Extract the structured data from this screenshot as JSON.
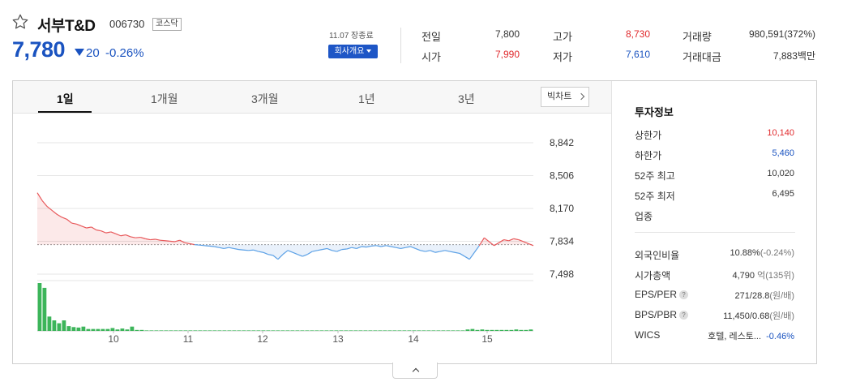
{
  "header": {
    "name": "서부T&D",
    "code": "006730",
    "market": "코스닥",
    "price": "7,780",
    "change": "20",
    "change_pct": "-0.26%",
    "date_close": "11.07 장종료",
    "company_button": "회사개요"
  },
  "stats": {
    "prev_close_label": "전일",
    "prev_close": "7,800",
    "open_label": "시가",
    "open": "7,990",
    "high_label": "고가",
    "high": "8,730",
    "low_label": "저가",
    "low": "7,610",
    "volume_label": "거래량",
    "volume": "980,591(372%)",
    "value_label": "거래대금",
    "value": "7,883백만"
  },
  "tabs": [
    "1일",
    "1개월",
    "3개월",
    "1년",
    "3년"
  ],
  "active_tab": "1일",
  "big_chart_label": "빅차트",
  "investment": {
    "title": "투자정보",
    "rows1": [
      {
        "label": "상한가",
        "value": "10,140",
        "color": "red"
      },
      {
        "label": "하한가",
        "value": "5,460",
        "color": "blue"
      },
      {
        "label": "52주 최고",
        "value": "10,020",
        "color": ""
      },
      {
        "label": "52주 최저",
        "value": "6,495",
        "color": ""
      },
      {
        "label": "업종",
        "value": "",
        "color": ""
      }
    ],
    "foreign_label": "외국인비율",
    "foreign_value": "10.88%",
    "foreign_change": "(-0.24%)",
    "mcap_label": "시가총액",
    "mcap_value": "4,790",
    "mcap_unit": "억(135위)",
    "eps_label": "EPS/PER",
    "eps_value": "271/28.8",
    "eps_unit": "(원/배)",
    "bps_label": "BPS/PBR",
    "bps_value": "11,450/0.68",
    "bps_unit": "(원/배)",
    "wics_label": "WICS",
    "wics_value": "호텔, 레스토...",
    "wics_change": "-0.46%"
  },
  "colors": {
    "up": "#e0292c",
    "down": "#1a53c0",
    "volume": "#3cb55a",
    "accent_button": "#1e56c6"
  },
  "chart_data": {
    "type": "line",
    "y_ticks": [
      "8,842",
      "8,506",
      "8,170",
      "7,834",
      "7,498"
    ],
    "ylim": [
      7498,
      8842
    ],
    "prev_close": 7800,
    "x_ticks": [
      "10",
      "11",
      "12",
      "13",
      "14",
      "15"
    ],
    "price_series": [
      8330,
      8250,
      8190,
      8150,
      8110,
      8080,
      8060,
      8020,
      8010,
      7990,
      7970,
      7980,
      7950,
      7940,
      7920,
      7930,
      7910,
      7890,
      7900,
      7880,
      7870,
      7875,
      7860,
      7850,
      7855,
      7845,
      7840,
      7835,
      7830,
      7845,
      7820,
      7810,
      7800,
      7795,
      7790,
      7785,
      7780,
      7770,
      7760,
      7770,
      7760,
      7750,
      7745,
      7740,
      7745,
      7730,
      7720,
      7700,
      7690,
      7650,
      7700,
      7740,
      7720,
      7700,
      7680,
      7700,
      7730,
      7740,
      7750,
      7760,
      7740,
      7730,
      7750,
      7755,
      7770,
      7760,
      7780,
      7775,
      7785,
      7790,
      7780,
      7790,
      7780,
      7770,
      7760,
      7770,
      7780,
      7760,
      7740,
      7730,
      7740,
      7720,
      7730,
      7740,
      7730,
      7720,
      7710,
      7680,
      7650,
      7720,
      7790,
      7870,
      7830,
      7790,
      7820,
      7850,
      7840,
      7860,
      7850,
      7830,
      7810,
      7790
    ],
    "volume_series": [
      100,
      90,
      30,
      22,
      16,
      22,
      10,
      8,
      7,
      9,
      4,
      4,
      4,
      4,
      4,
      6,
      3,
      5,
      3,
      9,
      2,
      2,
      1,
      1,
      1,
      1,
      1,
      1,
      1,
      1,
      1,
      1,
      1,
      1,
      1,
      1,
      1,
      1,
      1,
      1,
      1,
      1,
      1,
      1,
      1,
      1,
      1,
      1,
      1,
      1,
      1,
      1,
      1,
      1,
      1,
      1,
      1,
      1,
      1,
      1,
      1,
      1,
      1,
      1,
      1,
      1,
      1,
      1,
      1,
      1,
      1,
      1,
      1,
      1,
      1,
      1,
      1,
      1,
      1,
      1,
      1,
      1,
      1,
      1,
      1,
      1,
      1,
      1,
      3,
      4,
      2,
      3,
      2,
      2,
      2,
      2,
      2,
      2,
      3,
      2,
      2,
      3
    ]
  }
}
